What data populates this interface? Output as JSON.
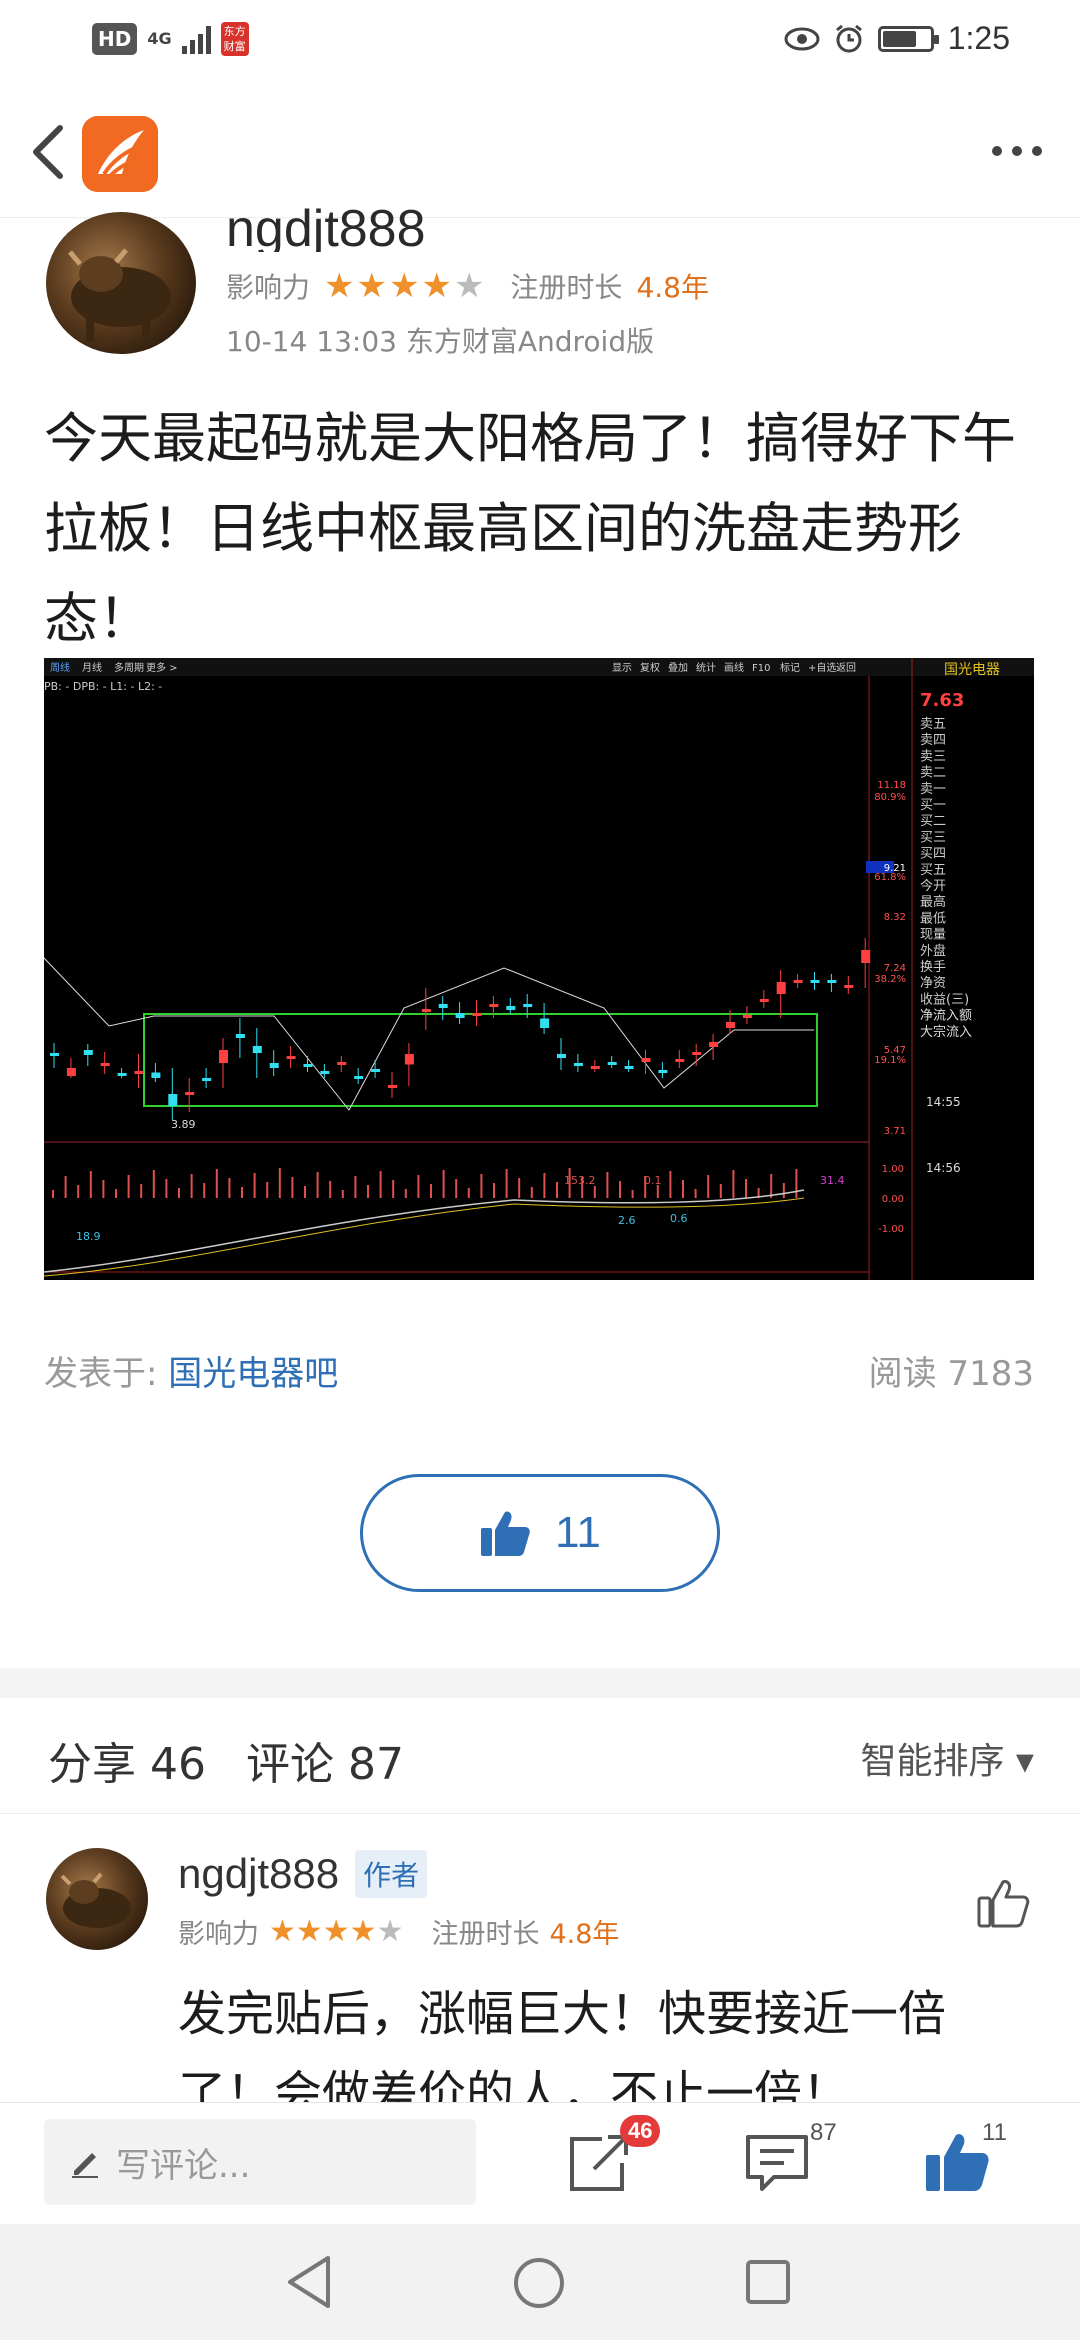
{
  "status_bar": {
    "hd": "HD",
    "network": "4G",
    "app_badge": "东方财富",
    "time": "1:25"
  },
  "post": {
    "username": "ngdjt888",
    "influence_label": "影响力",
    "influence_stars": 4,
    "influence_max": 5,
    "reg_label": "注册时长",
    "reg_value": "4.8年",
    "timestamp": "10-14 13:03 东方财富Android版",
    "content": "今天最起码就是大阳格局了！搞得好下午拉板！日线中枢最高区间的洗盘走势形态！",
    "forum_prefix": "发表于:",
    "forum_name": "国光电器吧",
    "read_label": "阅读 7183",
    "like_count": "11"
  },
  "stock_chart": {
    "toolbar_left": [
      "周线",
      "月线",
      "多周期",
      "更多 >"
    ],
    "toolbar_right": [
      "显示",
      "复权",
      "叠加",
      "统计",
      "画线",
      "F10",
      "标记",
      "+自选",
      "返回"
    ],
    "indicator_line": "PB: - DPB: - L1: - L2: -",
    "stock_name": "国光电器",
    "last_price": "7.63",
    "side_labels": [
      "卖五",
      "卖四",
      "卖三",
      "卖二",
      "卖一",
      "买一",
      "买二",
      "买三",
      "买四",
      "买五",
      "今开",
      "最高",
      "最低",
      "现量",
      "外盘",
      "换手",
      "净资",
      "收益(三)",
      "净流入额",
      "大宗流入"
    ],
    "time_1": "14:55",
    "time_2": "14:56",
    "price_ticks": [
      "11.18",
      "80.9%",
      "9.21",
      "61.8%",
      "8.32",
      "7.24",
      "38.2%",
      "5.47",
      "19.1%",
      "3.71"
    ],
    "low_label": "3.89",
    "volume_labels": [
      "153.2",
      "0.1",
      "31.4",
      "18.9",
      "2.6",
      "0.6"
    ],
    "macd_ticks": [
      "1.00",
      "0.00",
      "-1.00"
    ],
    "colors": {
      "up": "#ff4040",
      "down": "#30e0f0",
      "box": "#30d030",
      "bg": "#000000"
    }
  },
  "tabs": {
    "share": "分享 46",
    "comment": "评论 87",
    "sort": "智能排序 ▾"
  },
  "comment": {
    "username": "ngdjt888",
    "author_badge": "作者",
    "influence_label": "影响力",
    "reg_label": "注册时长",
    "reg_value": "4.8年",
    "text": "发完贴后，涨幅巨大！快要接近一倍了！会做差价的人，不止一倍！"
  },
  "bottom_bar": {
    "input_placeholder": "写评论...",
    "share_badge": "46",
    "comment_count": "87",
    "like_count": "11"
  },
  "icons": [
    "back-arrow-icon",
    "app-logo-icon",
    "more-icon",
    "thumbs-up-icon",
    "pencil-icon",
    "share-icon",
    "comment-icon",
    "nav-back-icon",
    "nav-home-icon",
    "nav-recent-icon"
  ]
}
